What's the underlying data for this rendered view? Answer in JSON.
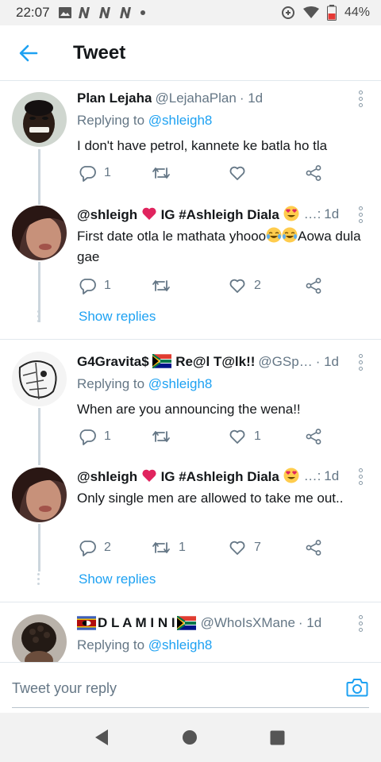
{
  "status_bar": {
    "time": "22:07",
    "battery_percent": "44%",
    "icons": [
      "gallery-icon",
      "n-notification-icon",
      "n-notification-icon",
      "n-notification-icon",
      "dot-icon",
      "data-saver-icon",
      "wifi-icon",
      "battery-low-icon"
    ]
  },
  "header": {
    "title": "Tweet"
  },
  "tweets": [
    {
      "display_name": "Plan Lejaha",
      "handle": "@LejahaPlan",
      "time": "· 1d",
      "replying_prefix": "Replying to ",
      "replying_to": "@shleigh8",
      "text": "I don't have petrol, kannete ke batla ho tla",
      "reply_count": "1",
      "retweet_count": "",
      "like_count": ""
    },
    {
      "display_name_a": "@shleigh",
      "display_name_b": "IG #Ashleigh Diala",
      "handle": "…:",
      "time": "1d",
      "text_a": "First date otla le mathata yhooo",
      "text_b": "Aowa dula gae",
      "reply_count": "1",
      "retweet_count": "",
      "like_count": "2"
    },
    {
      "display_name_a": "G4Gravita$",
      "display_name_b": "Re@l T@lk!!",
      "handle": "@GSp…",
      "time": "· 1d",
      "replying_prefix": "Replying to ",
      "replying_to": "@shleigh8",
      "text": "When are you announcing the wena!!",
      "reply_count": "1",
      "retweet_count": "",
      "like_count": "1"
    },
    {
      "display_name_a": "@shleigh",
      "display_name_b": "IG #Ashleigh Diala",
      "handle": "…:",
      "time": "1d",
      "text": "Only single men are allowed to take me out..",
      "reply_count": "2",
      "retweet_count": "1",
      "like_count": "7"
    },
    {
      "display_name": "D L A M I N I",
      "handle": "@WhoIsXMane",
      "time": "· 1d",
      "replying_prefix": "Replying to ",
      "replying_to": "@shleigh8"
    }
  ],
  "show_replies_label": "Show replies",
  "compose": {
    "placeholder": "Tweet your reply"
  },
  "colors": {
    "accent": "#1da1f2",
    "secondary_text": "#657786",
    "divider": "#e1e8ed"
  }
}
